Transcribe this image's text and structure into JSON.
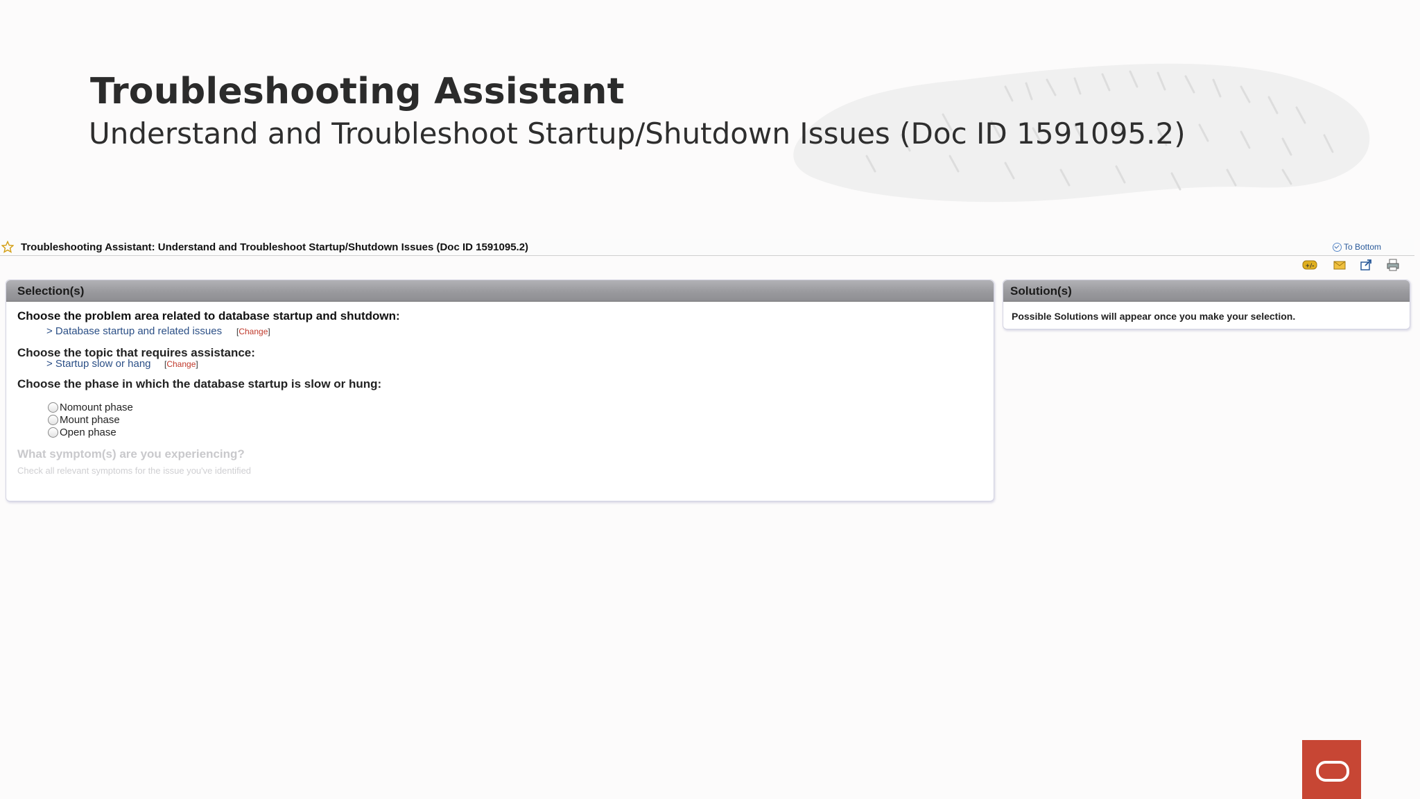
{
  "slide": {
    "title": "Troubleshooting Assistant",
    "subtitle": "Understand and Troubleshoot Startup/Shutdown Issues (Doc ID 1591095.2)"
  },
  "doc_header": {
    "title": "Troubleshooting Assistant: Understand and Troubleshoot Startup/Shutdown Issues (Doc ID 1591095.2)",
    "to_bottom": "To Bottom"
  },
  "toolbar_icons": [
    "font-size-icon",
    "email-icon",
    "open-new-window-icon",
    "print-icon"
  ],
  "selection_panel": {
    "header": "Selection(s)",
    "q1": "Choose the problem area related to database startup and shutdown:",
    "a1": "> Database startup and related issues",
    "q2": "Choose the topic that requires assistance:",
    "a2": "> Startup slow or hang",
    "change_label": "Change",
    "q3": "Choose the phase in which the database startup is slow or hung:",
    "options": [
      "Nomount phase",
      "Mount phase",
      "Open phase"
    ],
    "q4": "What symptom(s) are you experiencing?",
    "q4_hint": "Check all relevant symptoms for the issue you've identified"
  },
  "solution_panel": {
    "header": "Solution(s)",
    "text": "Possible Solutions will appear once you make your selection."
  },
  "colors": {
    "accent_red": "#c74634",
    "link_blue": "#2b4f86",
    "change_red": "#c0392b"
  }
}
